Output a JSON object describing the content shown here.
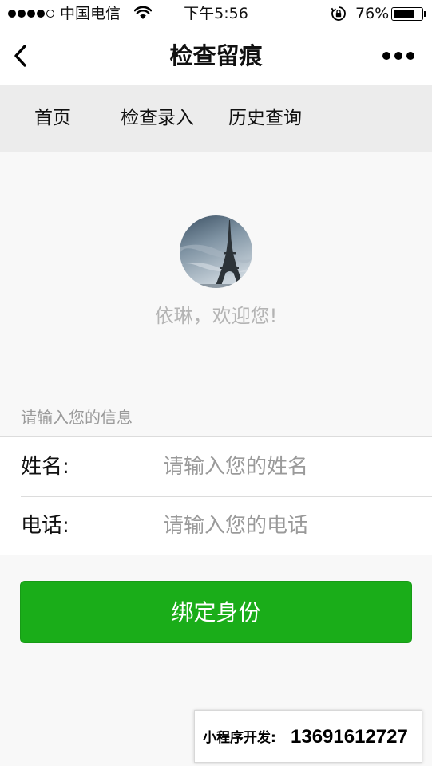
{
  "status_bar": {
    "carrier": "中国电信",
    "time": "下午5:56",
    "battery_percent": "76%",
    "battery_level": 0.76,
    "signal_bars_filled": 4,
    "signal_bars_total": 5,
    "icons": [
      "signal-icon",
      "wifi-icon",
      "rotation-lock-icon",
      "battery-icon"
    ]
  },
  "nav": {
    "title": "检查留痕",
    "back_icon": "chevron-left-icon",
    "more_icon": "more-dots-icon"
  },
  "tabs": [
    {
      "label": "首页"
    },
    {
      "label": "检查录入"
    },
    {
      "label": "历史查询"
    }
  ],
  "profile": {
    "greeting": "依琳，欢迎您!",
    "avatar_icon": "eiffel-tower-avatar"
  },
  "form": {
    "section_label": "请输入您的信息",
    "name_label": "姓名:",
    "name_placeholder": "请输入您的姓名",
    "name_value": "",
    "phone_label": "电话:",
    "phone_placeholder": "请输入您的电话",
    "phone_value": ""
  },
  "actions": {
    "bind_label": "绑定身份"
  },
  "contact": {
    "label": "小程序开发:",
    "phone": "13691612727"
  },
  "colors": {
    "primary_green": "#1aad19",
    "tab_bar_bg": "#ececec",
    "page_bg": "#f8f8f8",
    "placeholder": "#9a9a9a"
  }
}
